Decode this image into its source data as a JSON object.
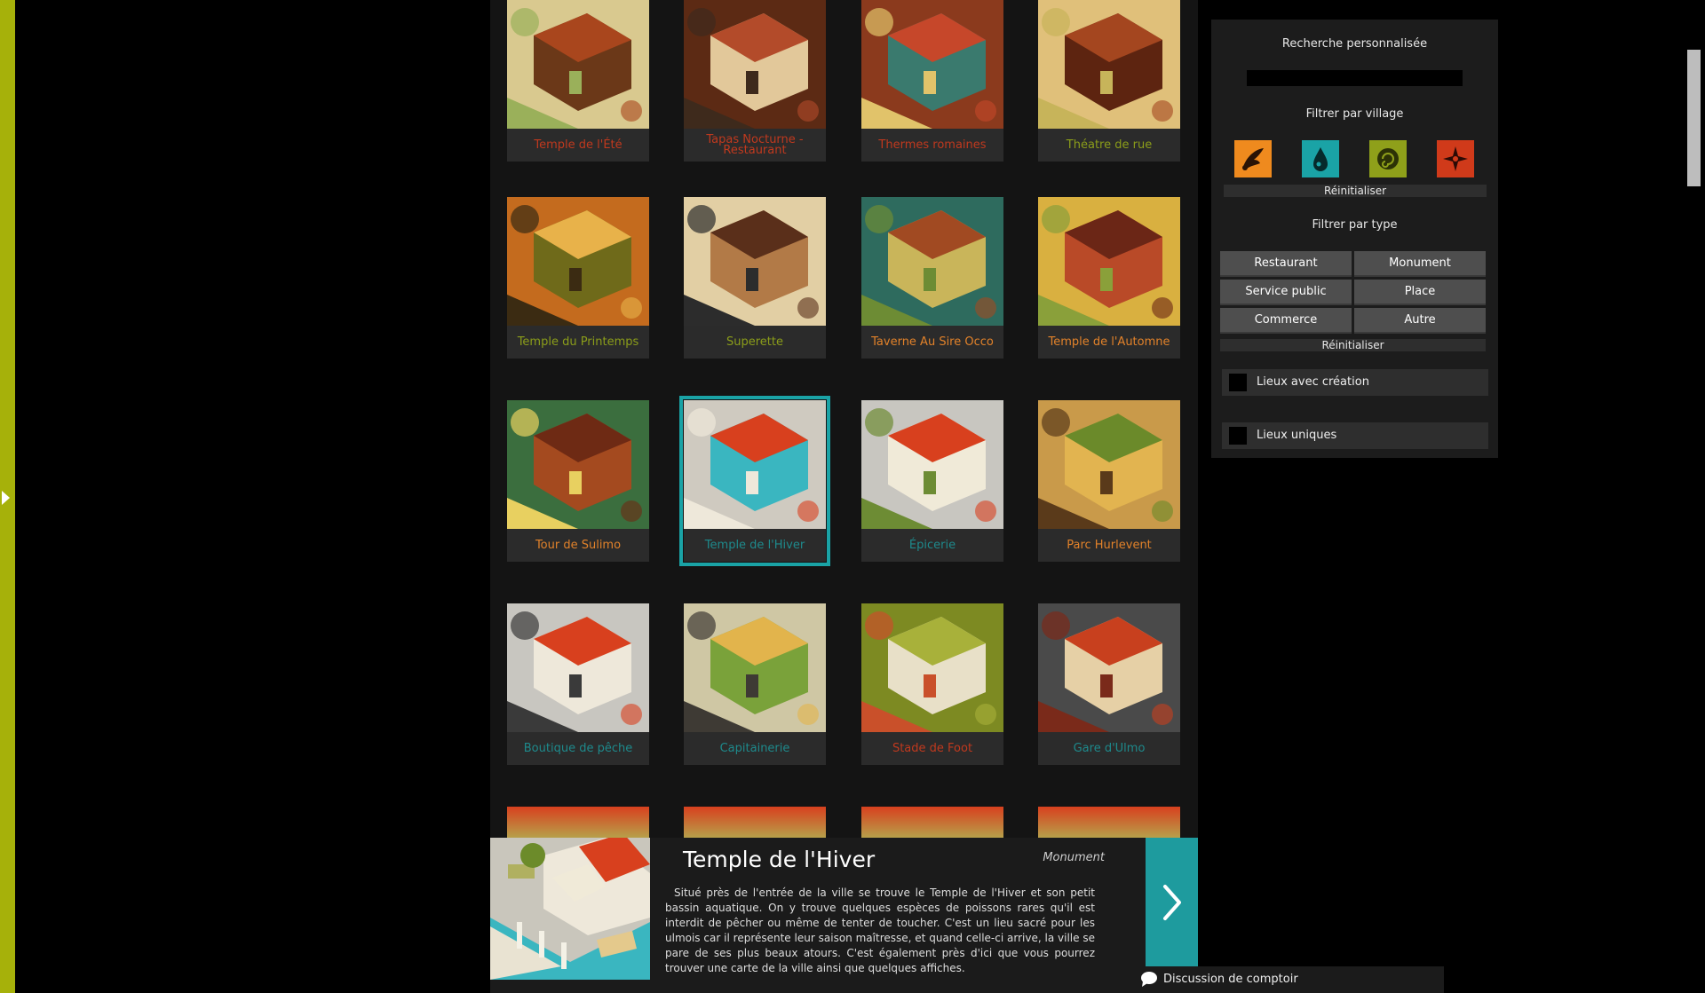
{
  "colors": {
    "accent_teal": "#1aa3a6",
    "strip_yellow": "#a6b10a",
    "label_red": "#c0391e",
    "label_green": "#8b9d1a",
    "label_orange": "#e2822a",
    "label_teal": "#1e8a8c"
  },
  "places": [
    {
      "name": "Temple de l'Été",
      "color": "#c0391e"
    },
    {
      "name": "Tapas Nocturne - Restaurant",
      "color": "#c0391e"
    },
    {
      "name": "Thermes romaines",
      "color": "#c0391e"
    },
    {
      "name": "Théatre de rue",
      "color": "#8b9d1a"
    },
    {
      "name": "Temple du Printemps",
      "color": "#8b9d1a"
    },
    {
      "name": "Superette",
      "color": "#8b9d1a"
    },
    {
      "name": "Taverne Au Sire Occo",
      "color": "#e2822a"
    },
    {
      "name": "Temple de l'Automne",
      "color": "#e2822a"
    },
    {
      "name": "Tour de Sulimo",
      "color": "#e2822a"
    },
    {
      "name": "Temple de l'Hiver",
      "color": "#1e8a8c",
      "selected": true
    },
    {
      "name": "Épicerie",
      "color": "#1e8a8c"
    },
    {
      "name": "Parc Hurlevent",
      "color": "#e2822a"
    },
    {
      "name": "Boutique de pêche",
      "color": "#1e8a8c"
    },
    {
      "name": "Capitainerie",
      "color": "#1e8a8c"
    },
    {
      "name": "Stade de Foot",
      "color": "#c0391e"
    },
    {
      "name": "Gare d'Ulmo",
      "color": "#1e8a8c"
    }
  ],
  "sidebar": {
    "search_title": "Recherche personnalisée",
    "search_value": "",
    "village_title": "Filtrer par village",
    "village_icons": [
      "wing-icon",
      "water-drop-icon",
      "spiral-icon",
      "star-compass-icon"
    ],
    "village_colors": [
      "#ef8a1e",
      "#1aa3a6",
      "#8fa01a",
      "#d03a1a"
    ],
    "reset_label": "Réinitialiser",
    "type_title": "Filtrer par type",
    "types": [
      "Restaurant",
      "Monument",
      "Service public",
      "Place",
      "Commerce",
      "Autre"
    ],
    "reset_label_2": "Réinitialiser",
    "check_creation": "Lieux avec création",
    "check_unique": "Lieux uniques"
  },
  "detail": {
    "title": "Temple de l'Hiver",
    "type": "Monument",
    "description": "Situé près de l'entrée de la ville se trouve le Temple de l'Hiver et son petit bassin aquatique. On y trouve quelques espèces de poissons rares qu'il est interdit de pêcher ou même de tenter de toucher. C'est un lieu sacré pour les ulmois car il représente leur saison maîtresse, et quand celle-ci arrive, la ville se pare de ses plus beaux atours. C'est également près d'ici que vous pourrez trouver une carte de la ville ainsi que quelques affiches."
  },
  "chat": {
    "label": "Discussion de comptoir"
  }
}
